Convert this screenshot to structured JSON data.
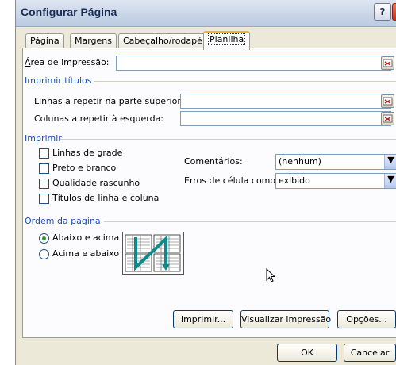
{
  "window": {
    "title": "Configurar Página",
    "help": "?"
  },
  "tabs": [
    "Página",
    "Margens",
    "Cabeçalho/rodapé",
    "Planilha"
  ],
  "active_tab": "Planilha",
  "print_area": {
    "label": "Área de impressão:",
    "value": ""
  },
  "print_titles": {
    "group": "Imprimir títulos",
    "rows_label": "Linhas a repetir na parte superior:",
    "rows_value": "",
    "cols_label": "Colunas a repetir à esquerda:",
    "cols_value": ""
  },
  "print": {
    "group": "Imprimir",
    "checkboxes": [
      {
        "label": "Linhas de grade",
        "checked": false
      },
      {
        "label": "Preto e branco",
        "checked": false
      },
      {
        "label": "Qualidade rascunho",
        "checked": false
      },
      {
        "label": "Títulos de linha e coluna",
        "checked": false
      }
    ],
    "comments_label": "Comentários:",
    "comments_value": "(nenhum)",
    "errors_label": "Erros de célula como:",
    "errors_value": "exibido"
  },
  "page_order": {
    "group": "Ordem da página",
    "options": [
      {
        "label": "Abaixo e acima",
        "selected": true
      },
      {
        "label": "Acima e abaixo",
        "selected": false
      }
    ]
  },
  "buttons": {
    "print": "Imprimir...",
    "preview": "Visualizar impressão",
    "options": "Opções...",
    "ok": "OK",
    "cancel": "Cancelar"
  },
  "colors": {
    "group_text": "#1d4fb3",
    "accent": "#f0b030",
    "order_arrow": "#0e8a8a"
  }
}
